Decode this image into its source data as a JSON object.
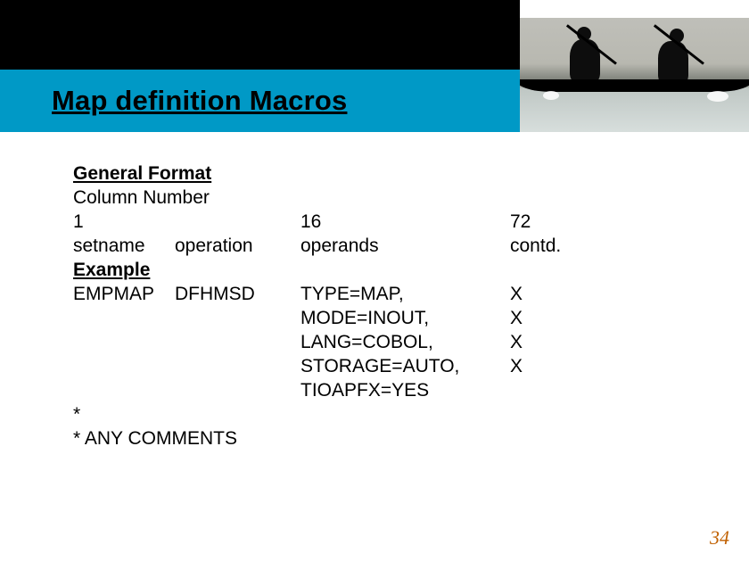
{
  "title": "Map definition Macros",
  "labels": {
    "general_format": "General Format",
    "column_number": "Column Number",
    "example": "Example"
  },
  "columns": {
    "col1_num": "1",
    "col2_num": "16",
    "col3_num": "72",
    "col1_hdr_a": "setname",
    "col1_hdr_b": "operation",
    "col2_hdr": "operands",
    "col3_hdr": "contd."
  },
  "example": {
    "setname": "EMPMAP",
    "operation": "DFHMSD",
    "operands": [
      "TYPE=MAP,",
      "MODE=INOUT,",
      "LANG=COBOL,",
      "STORAGE=AUTO,",
      "TIOAPFX=YES"
    ],
    "contd": [
      "X",
      "X",
      "X",
      "X",
      ""
    ]
  },
  "comments": {
    "star": "*",
    "line": "*   ANY COMMENTS"
  },
  "page_number": "34"
}
